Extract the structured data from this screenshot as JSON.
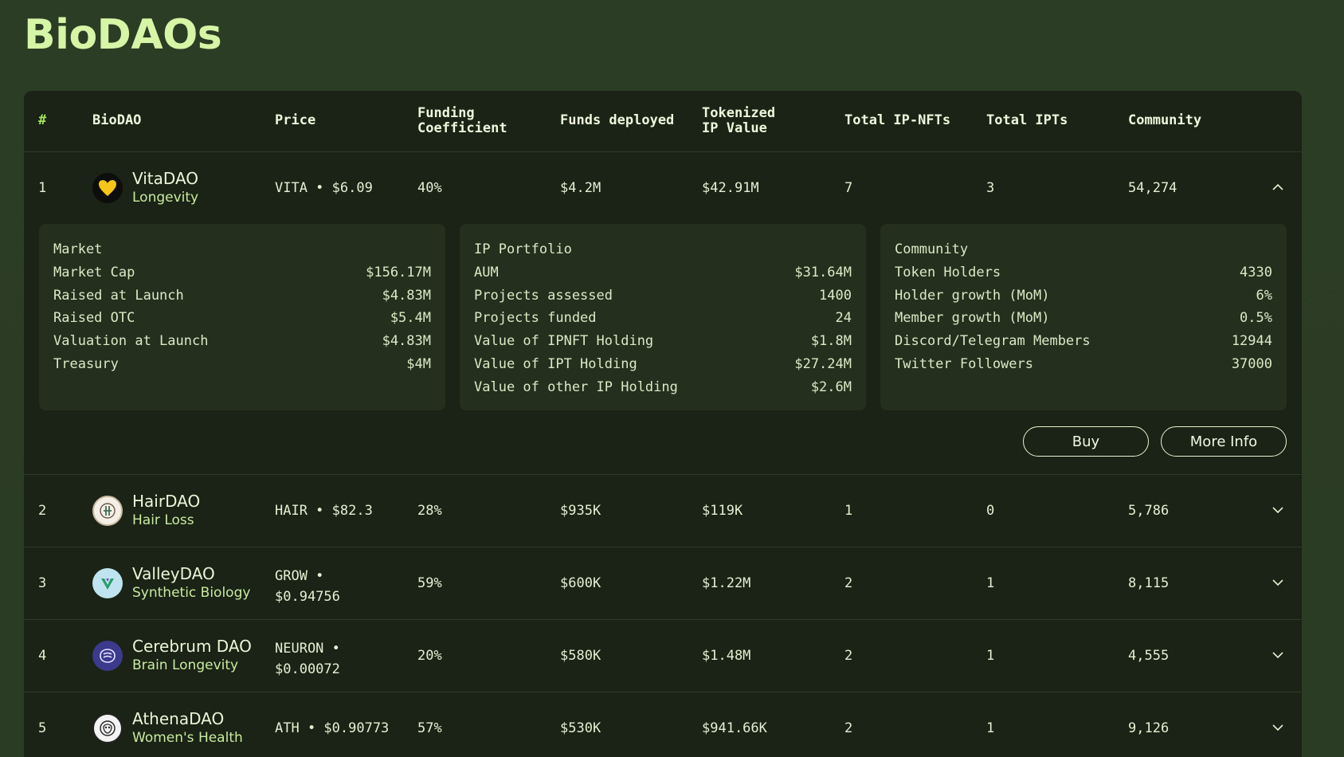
{
  "page_title": "BioDAOs",
  "headers": {
    "num": "#",
    "biodao": "BioDAO",
    "price": "Price",
    "funding_1": "Funding",
    "funding_2": "Coefficient",
    "funds": "Funds deployed",
    "tokenized_1": "Tokenized",
    "tokenized_2": "IP Value",
    "ipnfts": "Total IP-NFTs",
    "ipts": "Total IPTs",
    "community": "Community"
  },
  "rows": [
    {
      "num": "1",
      "name": "VitaDAO",
      "category": "Longevity",
      "price": "VITA • $6.09",
      "price_1": "",
      "price_2": "",
      "funding": "40%",
      "funds": "$4.2M",
      "tokenized": "$42.91M",
      "ipnfts": "7",
      "ipts": "3",
      "community": "54,274",
      "expanded": true,
      "logo": "vitadao-heart-logo"
    },
    {
      "num": "2",
      "name": "HairDAO",
      "category": "Hair Loss",
      "price": "HAIR • $82.3",
      "funding": "28%",
      "funds": "$935K",
      "tokenized": "$119K",
      "ipnfts": "1",
      "ipts": "0",
      "community": "5,786",
      "logo": "hairdao-logo"
    },
    {
      "num": "3",
      "name": "ValleyDAO",
      "category": "Synthetic Biology",
      "price_1": "GROW •",
      "price_2": "$0.94756",
      "funding": "59%",
      "funds": "$600K",
      "tokenized": "$1.22M",
      "ipnfts": "2",
      "ipts": "1",
      "community": "8,115",
      "logo": "valleydao-logo"
    },
    {
      "num": "4",
      "name": "Cerebrum DAO",
      "category": "Brain Longevity",
      "price_1": "NEURON •",
      "price_2": "$0.00072",
      "funding": "20%",
      "funds": "$580K",
      "tokenized": "$1.48M",
      "ipnfts": "2",
      "ipts": "1",
      "community": "4,555",
      "logo": "cerebrumdao-logo"
    },
    {
      "num": "5",
      "name": "AthenaDAO",
      "category": "Women's Health",
      "price": "ATH • $0.90773",
      "funding": "57%",
      "funds": "$530K",
      "tokenized": "$941.66K",
      "ipnfts": "2",
      "ipts": "1",
      "community": "9,126",
      "logo": "athenadao-logo"
    }
  ],
  "details": {
    "market": {
      "title": "Market",
      "items": [
        {
          "label": "Market Cap",
          "value": "$156.17M"
        },
        {
          "label": "Raised at Launch",
          "value": "$4.83M"
        },
        {
          "label": "Raised OTC",
          "value": "$5.4M"
        },
        {
          "label": "Valuation at Launch",
          "value": "$4.83M"
        },
        {
          "label": "Treasury",
          "value": "$4M"
        }
      ]
    },
    "ip": {
      "title": "IP Portfolio",
      "items": [
        {
          "label": "AUM",
          "value": "$31.64M"
        },
        {
          "label": "Projects assessed",
          "value": "1400"
        },
        {
          "label": "Projects funded",
          "value": "24"
        },
        {
          "label": "Value of IPNFT Holding",
          "value": "$1.8M"
        },
        {
          "label": "Value of IPT Holding",
          "value": "$27.24M"
        },
        {
          "label": "Value of other IP Holding",
          "value": "$2.6M"
        }
      ]
    },
    "community": {
      "title": "Community",
      "items": [
        {
          "label": "Token Holders",
          "value": "4330"
        },
        {
          "label": "Holder growth (MoM)",
          "value": "6%"
        },
        {
          "label": "Member growth (MoM)",
          "value": "0.5%"
        },
        {
          "label": "Discord/Telegram Members",
          "value": "12944"
        },
        {
          "label": "Twitter Followers",
          "value": "37000"
        }
      ]
    },
    "buy_label": "Buy",
    "more_info_label": "More Info"
  },
  "colors": {
    "accent": "#a6e35b",
    "title": "#d6f5a6",
    "background": "#2c3d25",
    "table": "#1a2315",
    "panel": "#242f1e"
  }
}
